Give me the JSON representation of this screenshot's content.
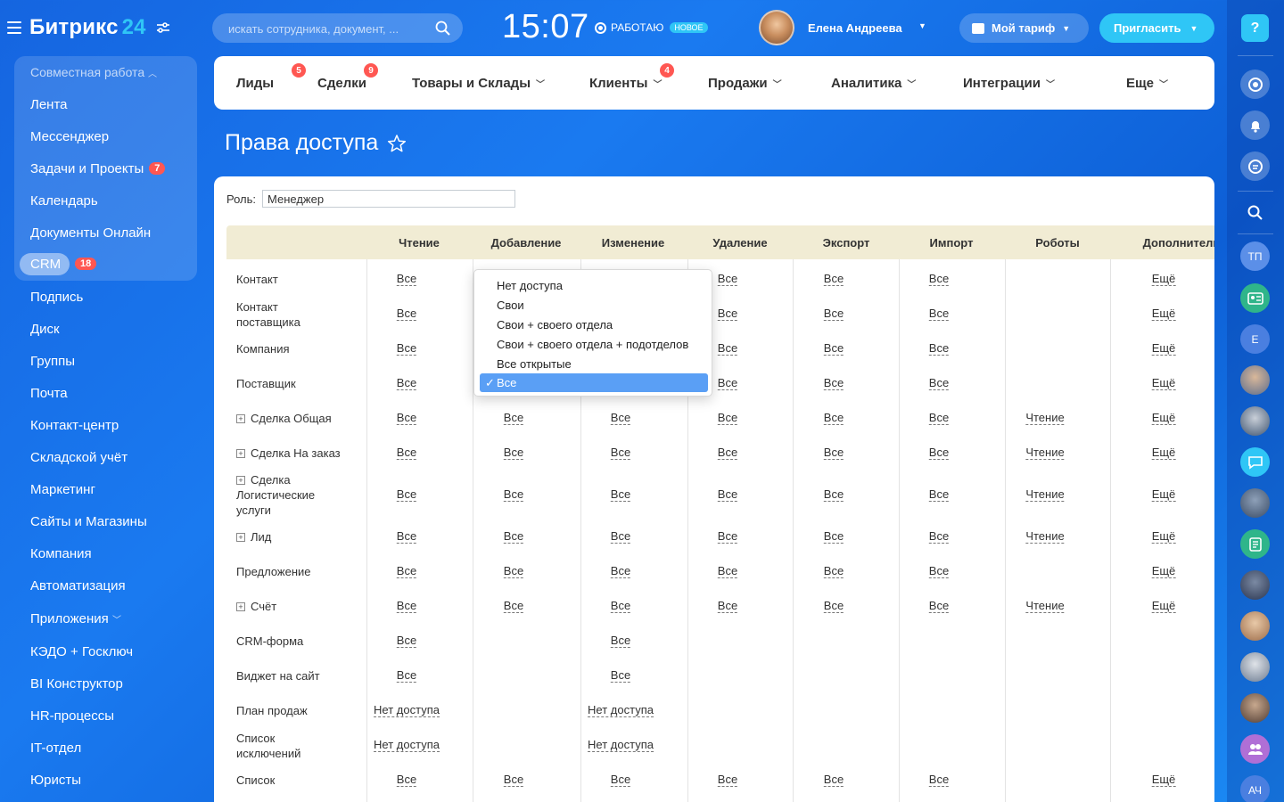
{
  "header": {
    "logo_text": "Битрикс",
    "logo_num": "24",
    "search_placeholder": "искать сотрудника, документ, ...",
    "clock": "15:07",
    "work_status": "РАБОТАЮ",
    "new_badge": "НОВОЕ",
    "user_name": "Елена Андреева",
    "tariff_label": "Мой тариф",
    "invite_label": "Пригласить"
  },
  "sidebar": {
    "group_title": "Совместная работа",
    "group_items": [
      {
        "label": "Лента"
      },
      {
        "label": "Мессенджер"
      },
      {
        "label": "Задачи и Проекты",
        "counter": "7"
      },
      {
        "label": "Календарь"
      },
      {
        "label": "Документы Онлайн"
      }
    ],
    "crm": {
      "label": "CRM",
      "counter": "18"
    },
    "items": [
      {
        "label": "Подпись"
      },
      {
        "label": "Диск"
      },
      {
        "label": "Группы"
      },
      {
        "label": "Почта"
      },
      {
        "label": "Контакт-центр"
      },
      {
        "label": "Складской учёт"
      },
      {
        "label": "Маркетинг"
      },
      {
        "label": "Сайты и Магазины"
      },
      {
        "label": "Компания"
      },
      {
        "label": "Автоматизация"
      },
      {
        "label": "Приложения"
      },
      {
        "label": "КЭДО + Госключ"
      },
      {
        "label": "BI Конструктор"
      },
      {
        "label": "HR-процессы"
      },
      {
        "label": "IT-отдел"
      },
      {
        "label": "Юристы"
      }
    ]
  },
  "crm_nav": {
    "tabs": [
      {
        "label": "Лиды",
        "badge": "5"
      },
      {
        "label": "Сделки",
        "badge": "9"
      },
      {
        "label": "Товары и Склады"
      },
      {
        "label": "Клиенты",
        "badge": "4"
      },
      {
        "label": "Продажи"
      },
      {
        "label": "Аналитика"
      },
      {
        "label": "Интеграции"
      },
      {
        "label": "Еще"
      }
    ]
  },
  "page": {
    "title": "Права доступа",
    "role_label": "Роль:",
    "role_value": "Менеджер"
  },
  "table": {
    "columns": [
      "Чтение",
      "Добавление",
      "Изменение",
      "Удаление",
      "Экспорт",
      "Импорт",
      "Роботы",
      "Дополнитель"
    ],
    "rows": [
      {
        "label": "Контакт",
        "plus": false,
        "cells": [
          "Все",
          "",
          "",
          "Все",
          "Все",
          "Все",
          "",
          "Ещё"
        ]
      },
      {
        "label": "Контакт поставщика",
        "plus": false,
        "cells": [
          "Все",
          "",
          "",
          "Все",
          "Все",
          "Все",
          "",
          "Ещё"
        ]
      },
      {
        "label": "Компания",
        "plus": false,
        "cells": [
          "Все",
          "",
          "",
          "Все",
          "Все",
          "Все",
          "",
          "Ещё"
        ]
      },
      {
        "label": "Поставщик",
        "plus": false,
        "cells": [
          "Все",
          "",
          "",
          "Все",
          "Все",
          "Все",
          "",
          "Ещё"
        ]
      },
      {
        "label": "Сделка Общая",
        "plus": true,
        "cells": [
          "Все",
          "Все",
          "Все",
          "Все",
          "Все",
          "Все",
          "Чтение",
          "Ещё"
        ]
      },
      {
        "label": "Сделка На заказ",
        "plus": true,
        "cells": [
          "Все",
          "Все",
          "Все",
          "Все",
          "Все",
          "Все",
          "Чтение",
          "Ещё"
        ]
      },
      {
        "label": "Сделка Логистические услуги",
        "plus": true,
        "cells": [
          "Все",
          "Все",
          "Все",
          "Все",
          "Все",
          "Все",
          "Чтение",
          "Ещё"
        ]
      },
      {
        "label": "Лид",
        "plus": true,
        "cells": [
          "Все",
          "Все",
          "Все",
          "Все",
          "Все",
          "Все",
          "Чтение",
          "Ещё"
        ]
      },
      {
        "label": "Предложение",
        "plus": false,
        "cells": [
          "Все",
          "Все",
          "Все",
          "Все",
          "Все",
          "Все",
          "",
          "Ещё"
        ]
      },
      {
        "label": "Счёт",
        "plus": true,
        "cells": [
          "Все",
          "Все",
          "Все",
          "Все",
          "Все",
          "Все",
          "Чтение",
          "Ещё"
        ]
      },
      {
        "label": "CRM-форма",
        "plus": false,
        "cells": [
          "Все",
          "",
          "Все",
          "",
          "",
          "",
          "",
          ""
        ]
      },
      {
        "label": "Виджет на сайт",
        "plus": false,
        "cells": [
          "Все",
          "",
          "Все",
          "",
          "",
          "",
          "",
          ""
        ]
      },
      {
        "label": "План продаж",
        "plus": false,
        "cells": [
          "Нет доступа",
          "",
          "Нет доступа",
          "",
          "",
          "",
          "",
          ""
        ]
      },
      {
        "label": "Список исключений",
        "plus": false,
        "cells": [
          "Нет доступа",
          "",
          "Нет доступа",
          "",
          "",
          "",
          "",
          ""
        ]
      },
      {
        "label": "Список",
        "plus": false,
        "cells": [
          "Все",
          "Все",
          "Все",
          "Все",
          "Все",
          "Все",
          "",
          "Ещё"
        ]
      }
    ]
  },
  "dropdown": {
    "options": [
      "Нет доступа",
      "Свои",
      "Свои + своего отдела",
      "Свои + своего отдела + подотделов",
      "Все открытые",
      "Все"
    ],
    "selected": "Все",
    "check": "✓"
  },
  "rightbar": {
    "help": "?",
    "initials_1": "ТП",
    "initials_2": "Е",
    "initials_3": "АЧ"
  }
}
